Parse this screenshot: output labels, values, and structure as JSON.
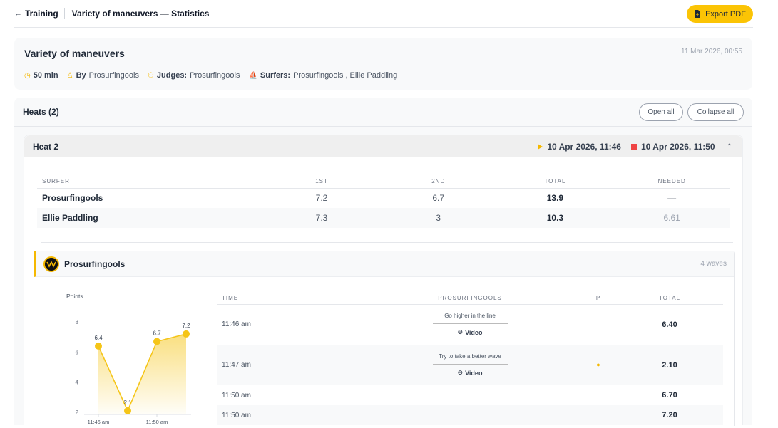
{
  "topbar": {
    "back_arrow": "←",
    "back_label": "Training",
    "crumb": "Variety of maneuvers — Statistics",
    "export_label": "Export PDF"
  },
  "session": {
    "title": "Variety of maneuvers",
    "date": "11 Mar 2026, 00:55",
    "duration": "50 min",
    "by_label": "By",
    "by_value": "Prosurfingools",
    "judges_label": "Judges:",
    "judges_value": "Prosurfingools",
    "surfers_label": "Surfers:",
    "surfers_value": "Prosurfingools , Ellie Paddling"
  },
  "heats": {
    "title": "Heats (2)",
    "open_all": "Open all",
    "collapse_all": "Collapse all",
    "heat": {
      "name": "Heat 2",
      "start": "10 Apr 2026, 11:46",
      "end": "10 Apr 2026, 11:50",
      "chevron": "⌃",
      "columns": [
        "SURFER",
        "1ST",
        "2ND",
        "TOTAL",
        "NEEDED"
      ],
      "rows": [
        {
          "surfer": "Prosurfingools",
          "first": "7.2",
          "second": "6.7",
          "total": "13.9",
          "needed": "—"
        },
        {
          "surfer": "Ellie Paddling",
          "first": "7.3",
          "second": "3",
          "total": "10.3",
          "needed": "6.61"
        }
      ]
    }
  },
  "surfer_card": {
    "name": "Prosurfingools",
    "waves": "4 waves",
    "columns": [
      "TIME",
      "PROSURFINGOOLS",
      "P",
      "TOTAL"
    ],
    "waves_list": [
      {
        "time": "11:46 am",
        "note": "Go higher in the line",
        "video": "Video",
        "total": "6.40"
      },
      {
        "time": "11:47 am",
        "note": "Try to take a better wave",
        "video": "Video",
        "total": "2.10"
      },
      {
        "time": "11:50 am",
        "note": "",
        "video": "",
        "total": "6.70"
      },
      {
        "time": "11:50 am",
        "note": "",
        "video": "",
        "total": "7.20"
      }
    ]
  },
  "chart_data": {
    "type": "area",
    "title": "",
    "ylabel": "Points",
    "xlabel": "",
    "x": [
      "11:46 am",
      "11:47 am",
      "11:50 am",
      "11:50 am"
    ],
    "x_tick_labels": [
      "11:46 am",
      "11:50 am"
    ],
    "series": [
      {
        "values": [
          6.4,
          2.1,
          6.7,
          7.2
        ],
        "value_labels": [
          "6.4",
          "2.1",
          "6.7",
          "7.2"
        ]
      }
    ],
    "y_ticks": [
      "8",
      "6",
      "4",
      "2"
    ],
    "ylim": [
      2,
      8
    ],
    "color": "#f5c518"
  }
}
